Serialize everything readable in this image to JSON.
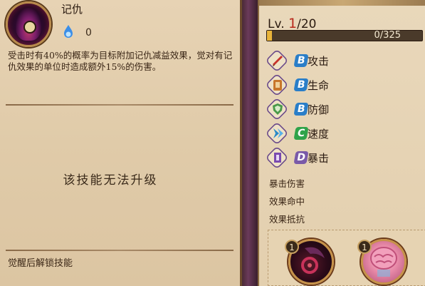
{
  "skill": {
    "name": "记仇",
    "orb_count": "0",
    "description": "受击时有40%的概率为目标附加记仇减益效果，觉对有记仇效果的单位时造成额外15%的伤害。",
    "no_upgrade_text": "该技能无法升级",
    "awaken_text": "觉醒后解锁技能"
  },
  "level": {
    "prefix": "Lv.",
    "current": "1",
    "max": "/20",
    "exp_text": "0/325",
    "exp_fraction": 0.03
  },
  "stats": [
    {
      "grade": "B",
      "label": "攻击",
      "icon": "attack-icon",
      "grade_color": "#2a7ec8"
    },
    {
      "grade": "B",
      "label": "生命",
      "icon": "health-icon",
      "grade_color": "#2a7ec8"
    },
    {
      "grade": "B",
      "label": "防御",
      "icon": "defense-icon",
      "grade_color": "#2a7ec8"
    },
    {
      "grade": "C",
      "label": "速度",
      "icon": "speed-icon",
      "grade_color": "#2fa34a"
    },
    {
      "grade": "D",
      "label": "暴击",
      "icon": "crit-icon",
      "grade_color": "#7a5aa8"
    }
  ],
  "sub_stats": [
    "暴击伤害",
    "效果命中",
    "效果抵抗"
  ],
  "souls": [
    {
      "num": "1",
      "icon": "dark-soul-icon"
    },
    {
      "num": "1",
      "icon": "pink-brain-soul-icon"
    }
  ]
}
